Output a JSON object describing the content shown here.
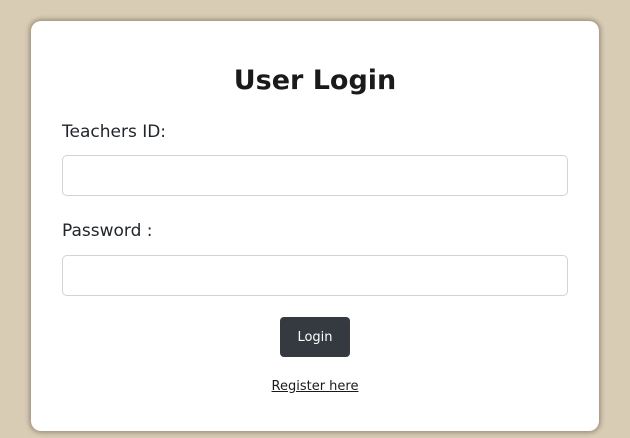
{
  "login": {
    "title": "User Login",
    "teachers_id_label": "Teachers ID:",
    "teachers_id_value": "",
    "password_label": "Password :",
    "password_value": "",
    "login_button": "Login",
    "register_link": "Register here"
  },
  "colors": {
    "page_background": "#d8ccb5",
    "card_background": "#ffffff",
    "button_background": "#343a40",
    "button_text": "#ffffff"
  }
}
